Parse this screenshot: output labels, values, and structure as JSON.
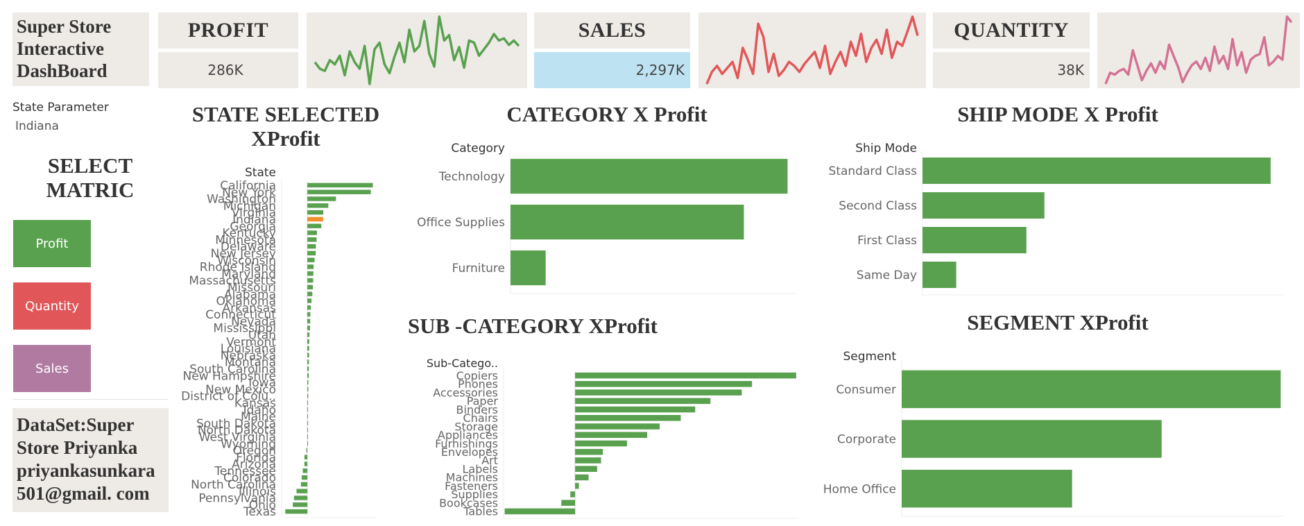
{
  "header": {
    "dashboard_title": [
      "Super Store",
      "Interactive",
      "DashBoard"
    ],
    "kpis": [
      {
        "label": "PROFIT",
        "value": "286K",
        "highlight": false,
        "spark_color": "#59a14f",
        "spark": [
          30,
          24,
          22,
          32,
          28,
          36,
          18,
          40,
          30,
          24,
          45,
          10,
          42,
          48,
          28,
          20,
          35,
          48,
          30,
          60,
          40,
          45,
          68,
          38,
          26,
          72,
          50,
          55,
          32,
          44,
          25,
          50,
          48,
          36,
          42,
          48,
          56,
          50,
          52,
          46,
          50,
          45
        ]
      },
      {
        "label": "SALES",
        "value": "2,297K",
        "highlight": true,
        "spark_color": "#e15759",
        "spark": [
          8,
          20,
          26,
          18,
          24,
          30,
          14,
          44,
          32,
          18,
          68,
          55,
          20,
          38,
          16,
          22,
          30,
          26,
          20,
          28,
          34,
          40,
          24,
          46,
          18,
          30,
          40,
          26,
          50,
          36,
          58,
          30,
          44,
          52,
          38,
          62,
          34,
          50,
          46,
          60,
          75,
          56
        ]
      },
      {
        "label": "QUANTITY",
        "value": "38K",
        "highlight": false,
        "spark_color": "#d37295",
        "spark": [
          10,
          22,
          20,
          24,
          26,
          20,
          46,
          30,
          14,
          24,
          32,
          22,
          34,
          26,
          52,
          40,
          28,
          12,
          22,
          30,
          34,
          26,
          38,
          24,
          50,
          32,
          40,
          26,
          58,
          30,
          44,
          22,
          36,
          40,
          42,
          60,
          30,
          34,
          40,
          36,
          82,
          76
        ]
      }
    ]
  },
  "sidebar": {
    "parameter_label": "State Parameter",
    "parameter_value": "Indiana",
    "select_title": [
      "SELECT",
      "MATRIC"
    ],
    "buttons": [
      {
        "label": "Profit",
        "color": "#59a14f"
      },
      {
        "label": "Quantity",
        "color": "#e15759"
      },
      {
        "label": "Sales",
        "color": "#b07aa1"
      }
    ],
    "dataset_text": [
      "DataSet:Super",
      "Store Priyanka",
      "priyankasunkara",
      "501@gmail. com"
    ]
  },
  "colors": {
    "bar": "#59a14f",
    "highlight": "#f28e2b"
  },
  "chart_data": [
    {
      "type": "bar",
      "orientation": "horizontal",
      "title": [
        "STATE SELECTED",
        "XProfit"
      ],
      "ylabel": "State",
      "highlight": "Indiana",
      "categories": [
        "California",
        "New York",
        "Washington",
        "Michigan",
        "Virginia",
        "Indiana",
        "Georgia",
        "Kentucky",
        "Minnesota",
        "Delaware",
        "New Jersey",
        "Wisconsin",
        "Rhode Island",
        "Maryland",
        "Massachusetts",
        "Missouri",
        "Alabama",
        "Oklahoma",
        "Arkansas",
        "Connecticut",
        "Nevada",
        "Mississippi",
        "Utah",
        "Vermont",
        "Louisiana",
        "Nebraska",
        "Montana",
        "South Carolina",
        "New Hampshire",
        "Iowa",
        "New Mexico",
        "District of Colu..",
        "Kansas",
        "Idaho",
        "Maine",
        "South Dakota",
        "North Dakota",
        "West Virginia",
        "Wyoming",
        "Oregon",
        "Florida",
        "Arizona",
        "Tennessee",
        "Colorado",
        "North Carolina",
        "Illinois",
        "Pennsylvania",
        "Ohio",
        "Texas"
      ],
      "values": [
        76381,
        74039,
        33403,
        24463,
        18598,
        18383,
        16250,
        11200,
        10823,
        9977,
        9773,
        8401,
        7286,
        7031,
        6786,
        6436,
        5787,
        4854,
        4009,
        3511,
        3317,
        3173,
        2547,
        2245,
        2196,
        2037,
        1833,
        1769,
        1707,
        1184,
        1157,
        1060,
        836,
        827,
        454,
        395,
        230,
        186,
        101,
        -1190,
        -3399,
        -3428,
        -5342,
        -6528,
        -7491,
        -12608,
        -15560,
        -16971,
        -25729
      ],
      "xlim": [
        -30000,
        80000
      ]
    },
    {
      "type": "bar",
      "orientation": "horizontal",
      "title": "CATEGORY X Profit",
      "ylabel": "Category",
      "categories": [
        "Technology",
        "Office Supplies",
        "Furniture"
      ],
      "values": [
        145455,
        122491,
        18451
      ],
      "xlim": [
        0,
        150000
      ]
    },
    {
      "type": "bar",
      "orientation": "horizontal",
      "title": "SHIP MODE X Profit",
      "ylabel": "Ship Mode",
      "categories": [
        "Standard Class",
        "Second Class",
        "First Class",
        "Same Day"
      ],
      "values": [
        164089,
        57447,
        48970,
        15892
      ],
      "xlim": [
        0,
        170000
      ]
    },
    {
      "type": "bar",
      "orientation": "horizontal",
      "title": "SUB -CATEGORY XProfit",
      "ylabel": "Sub-Catego..",
      "categories": [
        "Copiers",
        "Phones",
        "Accessories",
        "Paper",
        "Binders",
        "Chairs",
        "Storage",
        "Appliances",
        "Furnishings",
        "Envelopes",
        "Art",
        "Labels",
        "Machines",
        "Fasteners",
        "Supplies",
        "Bookcases",
        "Tables"
      ],
      "values": [
        55618,
        44516,
        41937,
        34054,
        30222,
        26590,
        21279,
        18138,
        13059,
        6964,
        6528,
        5546,
        3385,
        950,
        -1189,
        -3473,
        -17725
      ],
      "xlim": [
        -18000,
        56000
      ]
    },
    {
      "type": "bar",
      "orientation": "horizontal",
      "title": "SEGMENT XProfit",
      "ylabel": "Segment",
      "categories": [
        "Consumer",
        "Corporate",
        "Home Office"
      ],
      "values": [
        134119,
        91979,
        60299
      ],
      "xlim": [
        0,
        135000
      ]
    }
  ]
}
